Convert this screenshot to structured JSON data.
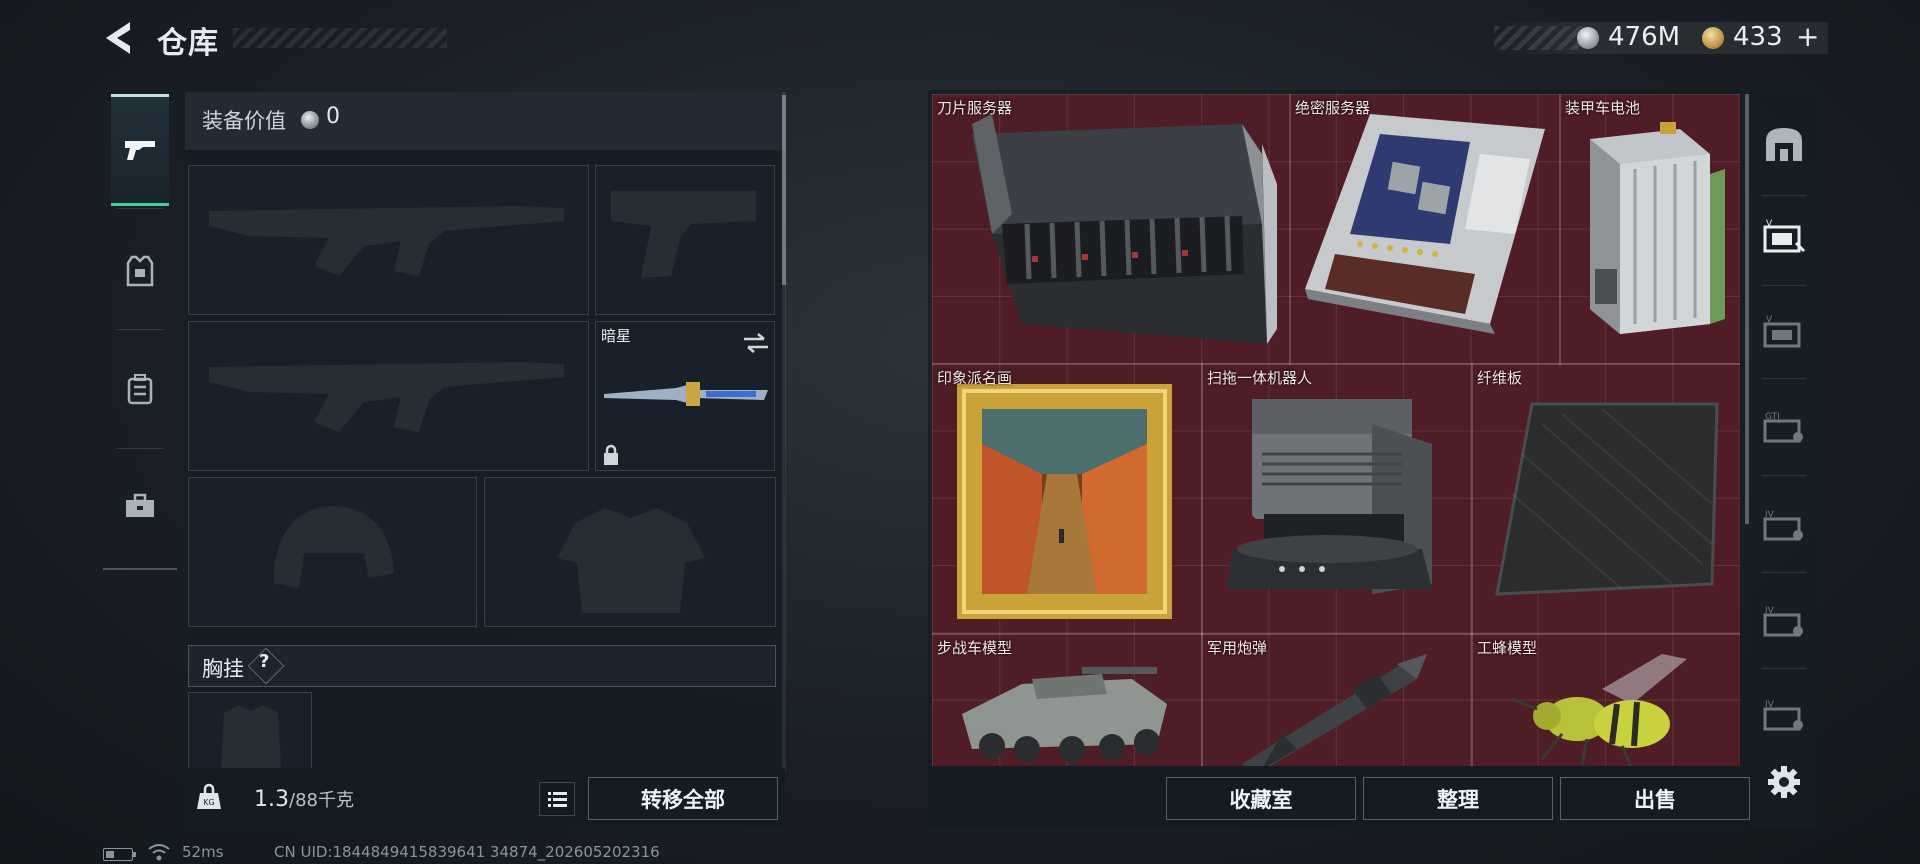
{
  "header": {
    "title": "仓库",
    "currency_silver": "476M",
    "currency_gold": "433",
    "currency_gold_plus": "+"
  },
  "equipment": {
    "value_label": "装备价值",
    "value": "0",
    "melee_name": "暗星",
    "section_chest_rig": "胸挂",
    "help_mark": "?",
    "weight_current": "1.3",
    "weight_capacity": "/88千克",
    "transfer_all": "转移全部"
  },
  "storage": {
    "items": [
      {
        "name": "刀片服务器"
      },
      {
        "name": "绝密服务器"
      },
      {
        "name": "装甲车电池"
      },
      {
        "name": "印象派名画"
      },
      {
        "name": "扫拖一体机器人"
      },
      {
        "name": "纤维板"
      },
      {
        "name": "步战车模型"
      },
      {
        "name": "军用炮弹"
      },
      {
        "name": "工蜂模型"
      }
    ],
    "actions": {
      "collection": "收藏室",
      "organize": "整理",
      "sell": "出售"
    }
  },
  "status_bar": {
    "ping": "52ms",
    "uid": "CN UID:1844849415839641 34874_202605202316"
  },
  "colors": {
    "accent": "#49c9a0",
    "storage_bg": "#4f1d25",
    "panel_bg": "#18212a"
  }
}
